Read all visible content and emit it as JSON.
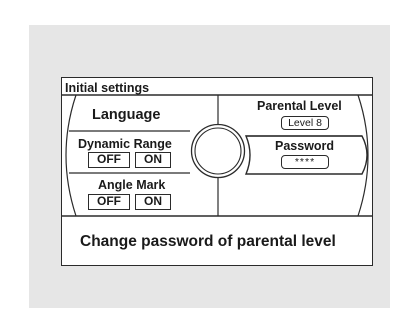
{
  "screen": {
    "title": "Initial settings",
    "language": {
      "label": "Language"
    },
    "dynamic_range": {
      "label": "Dynamic Range",
      "off": "OFF",
      "on": "ON"
    },
    "angle_mark": {
      "label": "Angle Mark",
      "off": "OFF",
      "on": "ON"
    },
    "parental_level": {
      "label": "Parental Level",
      "value": "Level 8"
    },
    "password": {
      "label": "Password",
      "value": "****"
    },
    "status": "Change password of parental level"
  },
  "colors": {
    "panel": "#e6e6e6",
    "line": "#2b2b2b",
    "screen": "#ffffff"
  }
}
